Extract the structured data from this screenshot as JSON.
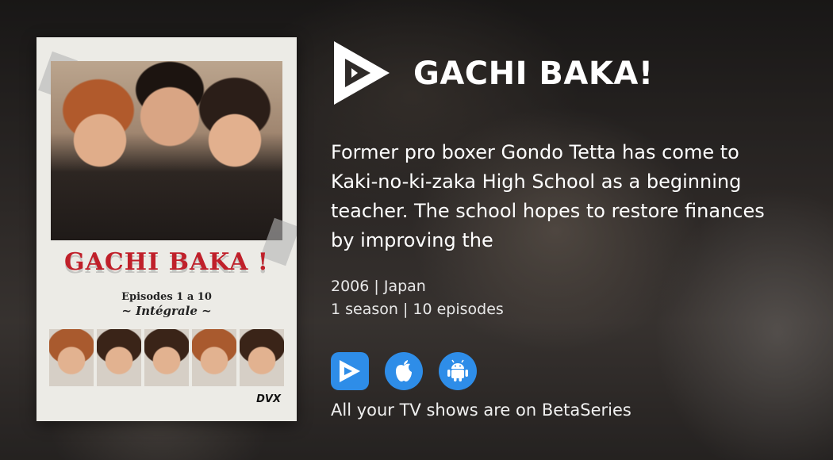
{
  "show": {
    "title": "GACHI BAKA!",
    "synopsis": "Former pro boxer Gondo Tetta has come to Kaki-no-ki-zaka High School as a beginning teacher. The school hopes to restore finances by improving the",
    "year_country": "2006 | Japan",
    "seasons_episodes": "1 season | 10 episodes"
  },
  "poster": {
    "title_art": "GACHI BAKA !",
    "episodes_line": "Episodes 1 a 10",
    "integrale_line": "~ Intégrale ~",
    "format_mark": "DVX"
  },
  "apps": [
    {
      "name": "betaseries-app-button",
      "icon": "betaseries-play-icon"
    },
    {
      "name": "apple-app-button",
      "icon": "apple-icon"
    },
    {
      "name": "android-app-button",
      "icon": "android-icon"
    }
  ],
  "tagline": "All your TV shows are on BetaSeries",
  "colors": {
    "accent": "#2e8de8",
    "text": "#ffffff"
  }
}
